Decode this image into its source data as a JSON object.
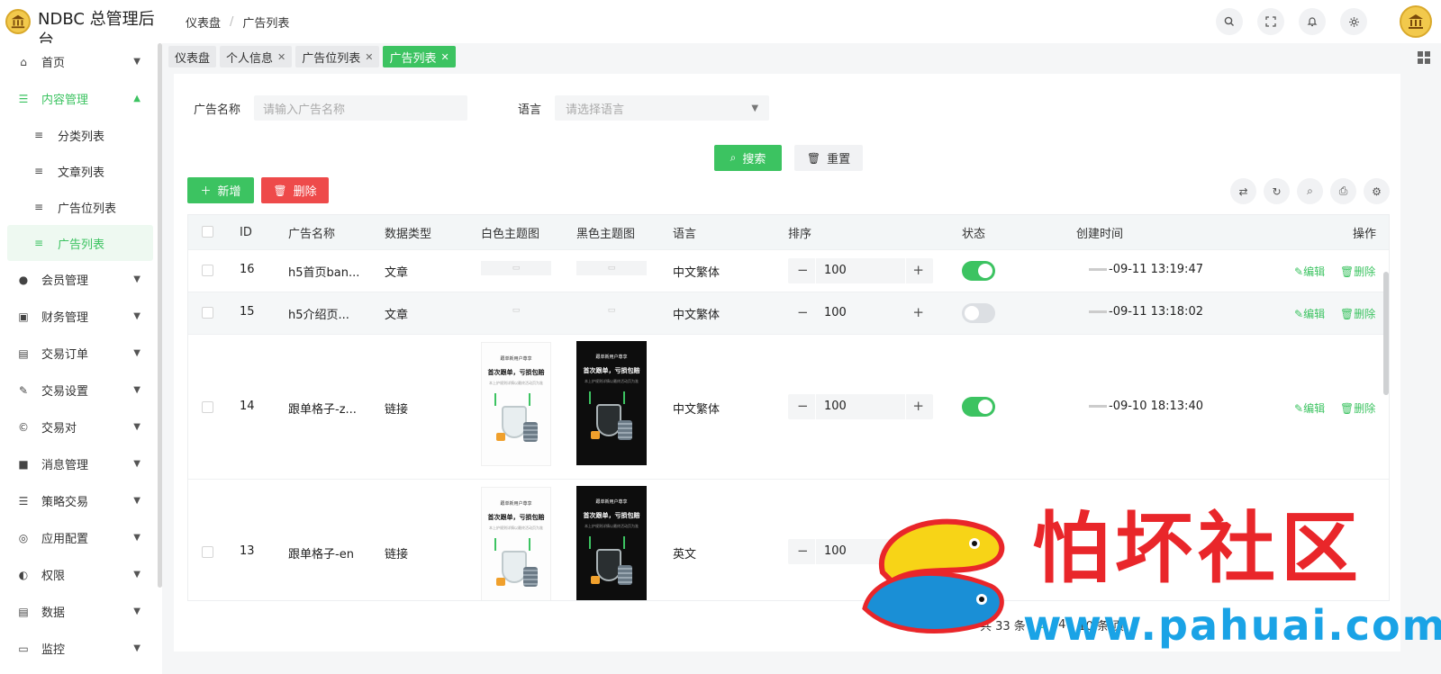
{
  "app": {
    "title": "NDBC 总管理后台"
  },
  "breadcrumb": [
    "仪表盘",
    "广告列表"
  ],
  "sidebar": {
    "items": [
      {
        "label": "首页",
        "icon": "home-icon"
      },
      {
        "label": "内容管理",
        "icon": "list-icon",
        "open": true
      },
      {
        "label": "会员管理",
        "icon": "user-icon"
      },
      {
        "label": "财务管理",
        "icon": "finance-icon"
      },
      {
        "label": "交易订单",
        "icon": "order-icon"
      },
      {
        "label": "交易设置",
        "icon": "wrench-icon"
      },
      {
        "label": "交易对",
        "icon": "copyright-icon"
      },
      {
        "label": "消息管理",
        "icon": "message-icon"
      },
      {
        "label": "策略交易",
        "icon": "menu-icon"
      },
      {
        "label": "应用配置",
        "icon": "coins-icon"
      },
      {
        "label": "权限",
        "icon": "user-gear-icon"
      },
      {
        "label": "数据",
        "icon": "data-icon"
      },
      {
        "label": "监控",
        "icon": "monitor-icon"
      }
    ],
    "sub_items": [
      {
        "label": "分类列表"
      },
      {
        "label": "文章列表"
      },
      {
        "label": "广告位列表"
      },
      {
        "label": "广告列表",
        "active": true
      }
    ]
  },
  "tabs": [
    {
      "label": "仪表盘",
      "closable": false
    },
    {
      "label": "个人信息",
      "closable": true
    },
    {
      "label": "广告位列表",
      "closable": true
    },
    {
      "label": "广告列表",
      "closable": true,
      "active": true
    }
  ],
  "filters": {
    "name_label": "广告名称",
    "name_placeholder": "请输入广告名称",
    "lang_label": "语言",
    "lang_placeholder": "请选择语言",
    "search_label": "搜索",
    "reset_label": "重置"
  },
  "actions": {
    "add_label": "新增",
    "delete_label": "删除"
  },
  "table": {
    "columns": [
      "ID",
      "广告名称",
      "数据类型",
      "白色主题图",
      "黑色主题图",
      "语言",
      "排序",
      "状态",
      "创建时间",
      "操作"
    ],
    "rows": [
      {
        "id": "16",
        "name": "h5首页ban...",
        "type": "文章",
        "lang": "中文繁体",
        "sort": "100",
        "status": true,
        "created": "-09-11 13:19:47",
        "edit": "编辑",
        "delete": "删除"
      },
      {
        "id": "15",
        "name": "h5介绍页...",
        "type": "文章",
        "lang": "中文繁体",
        "sort": "100",
        "status": false,
        "created": "-09-11 13:18:02",
        "edit": "编辑",
        "delete": "删除"
      },
      {
        "id": "14",
        "name": "跟单格子-z...",
        "type": "链接",
        "lang": "中文繁体",
        "sort": "100",
        "status": true,
        "created": "-09-10 18:13:40",
        "edit": "编辑",
        "delete": "删除"
      },
      {
        "id": "13",
        "name": "跟单格子-en",
        "type": "链接",
        "lang": "英文",
        "sort": "100",
        "status": false,
        "created": "",
        "edit": "编辑",
        "delete": "删除"
      }
    ],
    "poster": {
      "line1": "跟单新用户尊享",
      "line2": "首次跟单，亏损包赔",
      "line3": "本上护规则详情以最终活动页为准"
    }
  },
  "pagination": {
    "total_text": "共 33 条",
    "page_visible": "3",
    "page_next": "4",
    "page_size": "10 条/页"
  },
  "watermark": {
    "text": "怕坏社区",
    "url": "www.pahuai.com"
  },
  "colors": {
    "accent": "#3cc361",
    "danger": "#ee4a4a",
    "watermark_red": "#e9262a",
    "watermark_blue": "#1aa3e6"
  }
}
